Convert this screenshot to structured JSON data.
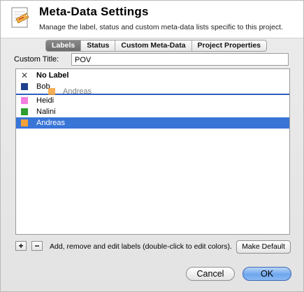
{
  "header": {
    "title": "Meta-Data Settings",
    "subtitle": "Manage the label, status and custom meta-data lists specific to this project.",
    "icon": "meta-data-badge-icon"
  },
  "tabs": [
    {
      "label": "Labels",
      "active": true
    },
    {
      "label": "Status",
      "active": false
    },
    {
      "label": "Custom Meta-Data",
      "active": false
    },
    {
      "label": "Project Properties",
      "active": false
    }
  ],
  "custom_title": {
    "label": "Custom Title:",
    "value": "POV"
  },
  "labels_list": {
    "items": [
      {
        "label": "No Label",
        "color": null,
        "icon": "x-mark-icon",
        "bold": true
      },
      {
        "label": "Bob",
        "color": "#1f3f8f"
      },
      {
        "label": "Heidi",
        "color": "#f47ee0"
      },
      {
        "label": "Nalini",
        "color": "#2e9e2e"
      },
      {
        "label": "Andreas",
        "color": "#f5a13a",
        "selected": true
      }
    ],
    "drag_ghost": {
      "label": "Andreas",
      "color": "#f5a13a"
    }
  },
  "footer": {
    "add_label": "+",
    "remove_label": "−",
    "hint": "Add, remove and edit labels (double-click to edit colors).",
    "make_default": "Make Default"
  },
  "buttons": {
    "cancel": "Cancel",
    "ok": "OK"
  },
  "colors": {
    "selection": "#3875d7",
    "drop_indicator": "#2d5fbf"
  }
}
